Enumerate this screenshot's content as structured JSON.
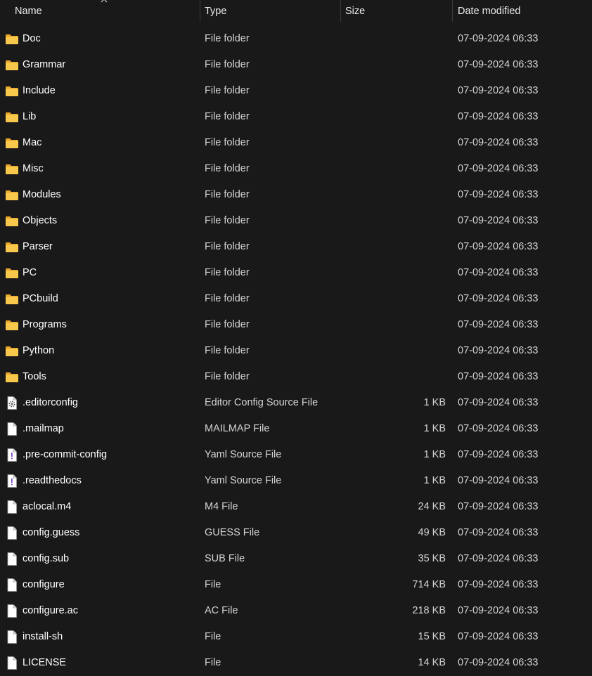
{
  "columns": {
    "name": "Name",
    "type": "Type",
    "size": "Size",
    "date": "Date modified"
  },
  "colors": {
    "background": "#191919",
    "folder": "#f5c543",
    "text": "#ffffff",
    "secondary_text": "#d4d4d4"
  },
  "items": [
    {
      "name": "Doc",
      "type": "File folder",
      "size": "",
      "date": "07-09-2024 06:33",
      "icon": "folder-icon"
    },
    {
      "name": "Grammar",
      "type": "File folder",
      "size": "",
      "date": "07-09-2024 06:33",
      "icon": "folder-icon"
    },
    {
      "name": "Include",
      "type": "File folder",
      "size": "",
      "date": "07-09-2024 06:33",
      "icon": "folder-icon"
    },
    {
      "name": "Lib",
      "type": "File folder",
      "size": "",
      "date": "07-09-2024 06:33",
      "icon": "folder-icon"
    },
    {
      "name": "Mac",
      "type": "File folder",
      "size": "",
      "date": "07-09-2024 06:33",
      "icon": "folder-icon"
    },
    {
      "name": "Misc",
      "type": "File folder",
      "size": "",
      "date": "07-09-2024 06:33",
      "icon": "folder-icon"
    },
    {
      "name": "Modules",
      "type": "File folder",
      "size": "",
      "date": "07-09-2024 06:33",
      "icon": "folder-icon"
    },
    {
      "name": "Objects",
      "type": "File folder",
      "size": "",
      "date": "07-09-2024 06:33",
      "icon": "folder-icon"
    },
    {
      "name": "Parser",
      "type": "File folder",
      "size": "",
      "date": "07-09-2024 06:33",
      "icon": "folder-icon"
    },
    {
      "name": "PC",
      "type": "File folder",
      "size": "",
      "date": "07-09-2024 06:33",
      "icon": "folder-icon"
    },
    {
      "name": "PCbuild",
      "type": "File folder",
      "size": "",
      "date": "07-09-2024 06:33",
      "icon": "folder-icon"
    },
    {
      "name": "Programs",
      "type": "File folder",
      "size": "",
      "date": "07-09-2024 06:33",
      "icon": "folder-icon"
    },
    {
      "name": "Python",
      "type": "File folder",
      "size": "",
      "date": "07-09-2024 06:33",
      "icon": "folder-icon"
    },
    {
      "name": "Tools",
      "type": "File folder",
      "size": "",
      "date": "07-09-2024 06:33",
      "icon": "folder-icon"
    },
    {
      "name": ".editorconfig",
      "type": "Editor Config Source File",
      "size": "1 KB",
      "date": "07-09-2024 06:33",
      "icon": "config-file-icon"
    },
    {
      "name": ".mailmap",
      "type": "MAILMAP File",
      "size": "1 KB",
      "date": "07-09-2024 06:33",
      "icon": "file-icon"
    },
    {
      "name": ".pre-commit-config",
      "type": "Yaml Source File",
      "size": "1 KB",
      "date": "07-09-2024 06:33",
      "icon": "yaml-file-icon"
    },
    {
      "name": ".readthedocs",
      "type": "Yaml Source File",
      "size": "1 KB",
      "date": "07-09-2024 06:33",
      "icon": "yaml-file-icon"
    },
    {
      "name": "aclocal.m4",
      "type": "M4 File",
      "size": "24 KB",
      "date": "07-09-2024 06:33",
      "icon": "file-icon"
    },
    {
      "name": "config.guess",
      "type": "GUESS File",
      "size": "49 KB",
      "date": "07-09-2024 06:33",
      "icon": "file-icon"
    },
    {
      "name": "config.sub",
      "type": "SUB File",
      "size": "35 KB",
      "date": "07-09-2024 06:33",
      "icon": "file-icon"
    },
    {
      "name": "configure",
      "type": "File",
      "size": "714 KB",
      "date": "07-09-2024 06:33",
      "icon": "file-icon"
    },
    {
      "name": "configure.ac",
      "type": "AC File",
      "size": "218 KB",
      "date": "07-09-2024 06:33",
      "icon": "file-icon"
    },
    {
      "name": "install-sh",
      "type": "File",
      "size": "15 KB",
      "date": "07-09-2024 06:33",
      "icon": "file-icon"
    },
    {
      "name": "LICENSE",
      "type": "File",
      "size": "14 KB",
      "date": "07-09-2024 06:33",
      "icon": "file-icon"
    }
  ]
}
